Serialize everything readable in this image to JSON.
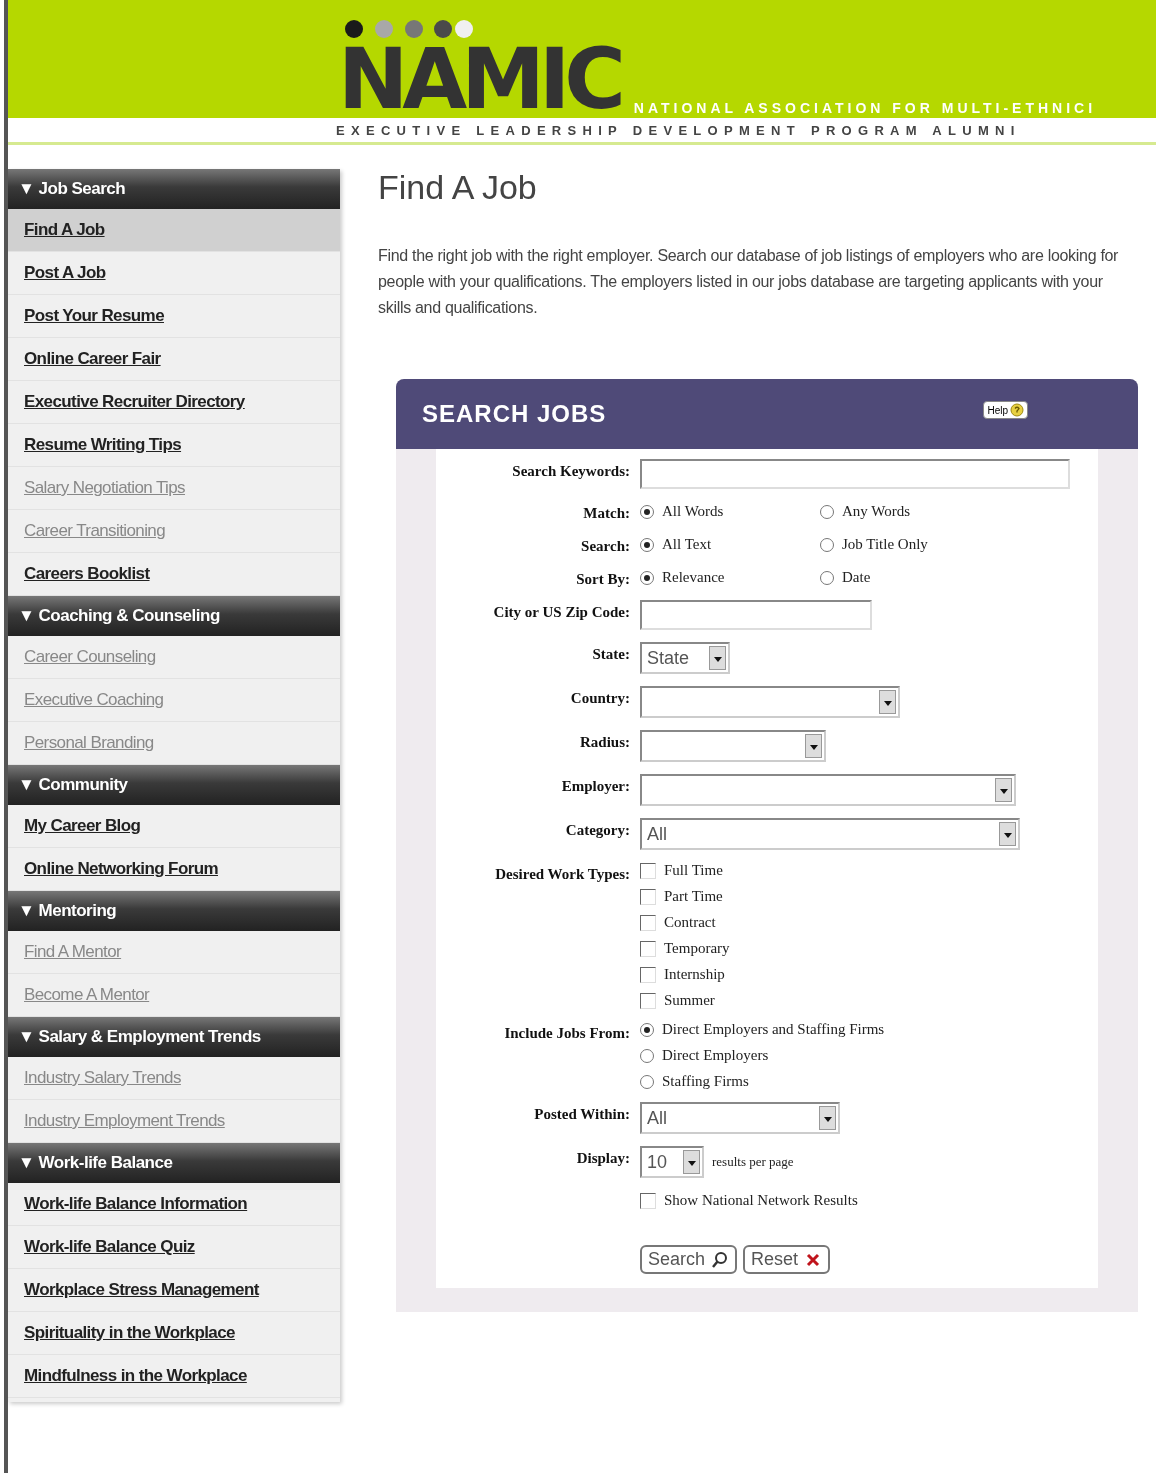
{
  "header": {
    "logo": "NAMIC",
    "tagline": "NATIONAL ASSOCIATION FOR MULTI-ETHNICI",
    "subtitle": "EXECUTIVE LEADERSHIP DEVELOPMENT PROGRAM ALUMNI"
  },
  "sidebar": {
    "sections": [
      {
        "title": "▼ Job Search",
        "items": [
          {
            "label": "Find A Job",
            "selected": true,
            "visited": false
          },
          {
            "label": "Post A Job",
            "selected": false,
            "visited": false
          },
          {
            "label": "Post Your Resume",
            "selected": false,
            "visited": false
          },
          {
            "label": "Online Career Fair",
            "selected": false,
            "visited": false
          },
          {
            "label": "Executive Recruiter Directory",
            "selected": false,
            "visited": false
          },
          {
            "label": "Resume Writing Tips",
            "selected": false,
            "visited": false
          },
          {
            "label": "Salary Negotiation Tips",
            "selected": false,
            "visited": true
          },
          {
            "label": "Career Transitioning",
            "selected": false,
            "visited": true
          },
          {
            "label": "Careers Booklist",
            "selected": false,
            "visited": false
          }
        ]
      },
      {
        "title": "▼ Coaching & Counseling",
        "items": [
          {
            "label": "Career Counseling",
            "selected": false,
            "visited": true
          },
          {
            "label": "Executive Coaching",
            "selected": false,
            "visited": true
          },
          {
            "label": "Personal Branding",
            "selected": false,
            "visited": true
          }
        ]
      },
      {
        "title": "▼ Community",
        "items": [
          {
            "label": "My Career Blog",
            "selected": false,
            "visited": false
          },
          {
            "label": "Online Networking Forum",
            "selected": false,
            "visited": false
          }
        ]
      },
      {
        "title": "▼ Mentoring",
        "items": [
          {
            "label": "Find A Mentor",
            "selected": false,
            "visited": true
          },
          {
            "label": "Become A Mentor",
            "selected": false,
            "visited": true
          }
        ]
      },
      {
        "title": "▼ Salary & Employment Trends",
        "items": [
          {
            "label": "Industry Salary Trends",
            "selected": false,
            "visited": true
          },
          {
            "label": "Industry Employment Trends",
            "selected": false,
            "visited": true
          }
        ]
      },
      {
        "title": "▼ Work-life Balance",
        "items": [
          {
            "label": "Work-life Balance Information",
            "selected": false,
            "visited": false
          },
          {
            "label": "Work-life Balance Quiz",
            "selected": false,
            "visited": false
          },
          {
            "label": "Workplace Stress Management",
            "selected": false,
            "visited": false
          },
          {
            "label": "Spirituality in the Workplace",
            "selected": false,
            "visited": false
          },
          {
            "label": "Mindfulness in the Workplace",
            "selected": false,
            "visited": false
          }
        ]
      }
    ]
  },
  "page": {
    "title": "Find A Job",
    "intro": "Find the right job with the right employer. Search our database of job listings of employers who are looking for people with your qualifications. The employers listed in our jobs database are targeting applicants with your skills and qualifications."
  },
  "search_panel": {
    "title": "SEARCH JOBS",
    "help": "Help",
    "fields": [
      {
        "kind": "text",
        "label": "Search Keywords:"
      },
      {
        "kind": "radio",
        "label": "Match:",
        "options": [
          {
            "label": "All Words",
            "selected": true
          },
          {
            "label": "Any Words",
            "selected": false
          }
        ]
      },
      {
        "kind": "radio",
        "label": "Search:",
        "options": [
          {
            "label": "All Text",
            "selected": true
          },
          {
            "label": "Job Title Only",
            "selected": false
          }
        ]
      },
      {
        "kind": "radio",
        "label": "Sort By:",
        "options": [
          {
            "label": "Relevance",
            "selected": true
          },
          {
            "label": "Date",
            "selected": false
          }
        ]
      },
      {
        "kind": "text",
        "label": "City or US Zip Code:"
      },
      {
        "kind": "select",
        "label": "State:",
        "value": "State"
      },
      {
        "kind": "select",
        "label": "Country:"
      },
      {
        "kind": "select",
        "label": "Radius:"
      },
      {
        "kind": "select",
        "label": "Employer:"
      },
      {
        "kind": "select",
        "label": "Category:",
        "value": "All"
      },
      {
        "kind": "checkboxes",
        "label": "Desired Work Types:",
        "options": [
          {
            "label": "Full Time",
            "checked": false
          },
          {
            "label": "Part Time",
            "checked": false
          },
          {
            "label": "Contract",
            "checked": false
          },
          {
            "label": "Temporary",
            "checked": false
          },
          {
            "label": "Internship",
            "checked": false
          },
          {
            "label": "Summer",
            "checked": false
          }
        ]
      },
      {
        "kind": "radio_list",
        "label": "Include Jobs From:",
        "options": [
          {
            "label": "Direct Employers and Staffing Firms",
            "selected": true
          },
          {
            "label": "Direct Employers",
            "selected": false
          },
          {
            "label": "Staffing Firms",
            "selected": false
          }
        ]
      },
      {
        "kind": "select",
        "label": "Posted Within:",
        "value": "All"
      },
      {
        "kind": "select",
        "label": "Display:",
        "value": "10",
        "suffix": "results per page"
      },
      {
        "kind": "checkboxes",
        "options": [
          {
            "label": "Show National Network Results",
            "checked": false
          }
        ]
      }
    ],
    "buttons": [
      {
        "kind": "search",
        "label": "Search"
      },
      {
        "kind": "reset",
        "label": "Reset"
      }
    ]
  }
}
